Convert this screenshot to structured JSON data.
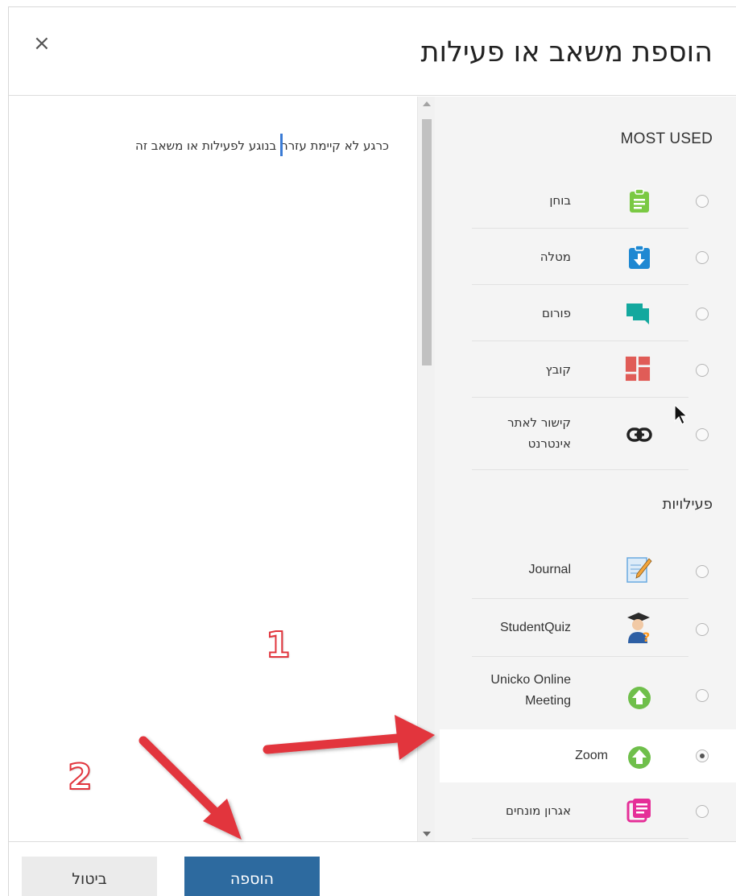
{
  "dialog": {
    "title": "הוספת משאב או פעילות",
    "close_icon": "×"
  },
  "help": {
    "text": "כרגע לא קיימת עזרה בנוגע לפעילות או משאב זה"
  },
  "sections": {
    "most_used": "MOST USED",
    "activities": "פעילויות"
  },
  "options": [
    {
      "label": "בוחן",
      "icon": "quiz-icon",
      "color": "#7ac943",
      "selected": false
    },
    {
      "label": "מטלה",
      "icon": "assignment-icon",
      "color": "#1f88d2",
      "selected": false
    },
    {
      "label": "פורום",
      "icon": "forum-icon",
      "color": "#13a89e",
      "selected": false
    },
    {
      "label": "קובץ",
      "icon": "file-icon",
      "color": "#e05c57",
      "selected": false
    },
    {
      "label": "קישור לאתר אינטרנט",
      "icon": "url-link-icon",
      "color": "#222222",
      "selected": false
    },
    {
      "label": "Journal",
      "icon": "journal-icon",
      "color": "#6aa9e0",
      "selected": false
    },
    {
      "label": "StudentQuiz",
      "icon": "studentquiz-icon",
      "color": "#ff9a1f",
      "selected": false
    },
    {
      "label": "Unicko Online Meeting",
      "icon": "upload-cloud-icon",
      "color": "#6fbf4b",
      "selected": false
    },
    {
      "label": "Zoom",
      "icon": "upload-cloud-icon",
      "color": "#6fbf4b",
      "selected": true
    },
    {
      "label": "אגרון מונחים",
      "icon": "glossary-icon",
      "color": "#e52f98",
      "selected": false
    }
  ],
  "footer": {
    "add_label": "הוספה",
    "cancel_label": "ביטול"
  },
  "annotations": {
    "step1": "1",
    "step2": "2",
    "arrow_color": "#e2353d"
  }
}
